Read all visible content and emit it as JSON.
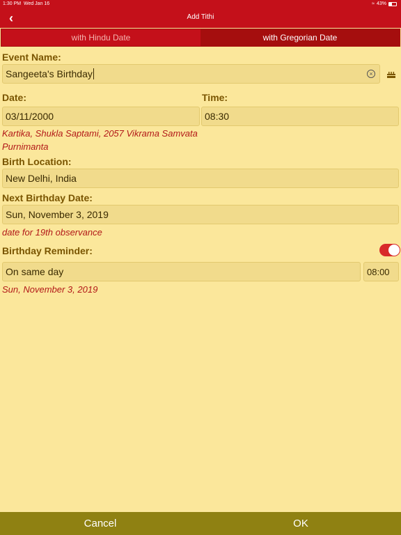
{
  "status_bar": {
    "time": "1:30 PM",
    "date": "Wed Jan 16",
    "battery": "43%",
    "battery_level": 0.43
  },
  "nav": {
    "title": "Add Tithi"
  },
  "tabs": [
    {
      "label": "with Hindu Date"
    },
    {
      "label": "with Gregorian Date"
    }
  ],
  "event": {
    "label": "Event Name:",
    "value": "Sangeeta's Birthday"
  },
  "date": {
    "label": "Date:",
    "value": "03/11/2000"
  },
  "time": {
    "label": "Time:",
    "value": "08:30"
  },
  "hindu_date": {
    "line1": "Kartika, Shukla Saptami, 2057 Vikrama Samvata",
    "line2": "Purnimanta"
  },
  "birth_location": {
    "label": "Birth Location:",
    "value": "New Delhi, India"
  },
  "next_birthday": {
    "label": "Next Birthday Date:",
    "value": "Sun, November 3, 2019",
    "note": "date for 19th observance"
  },
  "reminder": {
    "label": "Birthday Reminder:",
    "enabled": true,
    "when": "On same day",
    "time": "08:00",
    "date": "Sun, November 3, 2019"
  },
  "buttons": {
    "cancel": "Cancel",
    "ok": "OK"
  },
  "colors": {
    "primary": "#c4101a",
    "background": "#fbe79b",
    "bottom_bar": "#8f8112",
    "accent_text": "#b21818"
  }
}
